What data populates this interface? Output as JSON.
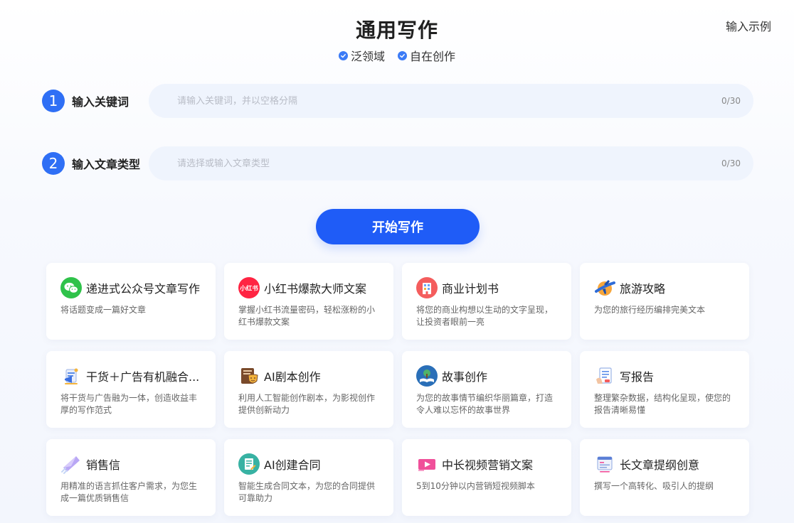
{
  "header": {
    "title": "通用写作",
    "tags": [
      "泛领域",
      "自在创作"
    ],
    "example_link": "输入示例"
  },
  "form": {
    "keyword": {
      "step": "1",
      "label": "输入关键词",
      "placeholder": "请输入关键词，并以空格分隔",
      "counter": "0/30"
    },
    "type": {
      "step": "2",
      "label": "输入文章类型",
      "placeholder": "请选择或输入文章类型",
      "counter": "0/30"
    }
  },
  "start_button": "开始写作",
  "cards": [
    {
      "title": "递进式公众号文章写作",
      "desc": "将话题变成一篇好文章",
      "icon": "wechat-icon"
    },
    {
      "title": "小红书爆款大师文案",
      "desc": "掌握小红书流量密码，轻松涨粉的小红书爆款文案",
      "icon": "xiaohongshu-icon",
      "icon_text": "小红书"
    },
    {
      "title": "商业计划书",
      "desc": "将您的商业构想以生动的文字呈现，让投资者眼前一亮",
      "icon": "building-icon"
    },
    {
      "title": "旅游攻略",
      "desc": "为您的旅行经历编排完美文本",
      "icon": "airplane-icon"
    },
    {
      "title": "干货＋广告有机融合...",
      "desc": "将干货与广告融为一体，创造收益丰厚的写作范式",
      "icon": "megaphone-icon"
    },
    {
      "title": "AI剧本创作",
      "desc": "利用人工智能创作剧本，为影视创作提供创新动力",
      "icon": "drama-mask-icon"
    },
    {
      "title": "故事创作",
      "desc": "为您的故事情节编织华丽篇章，打造令人难以忘怀的故事世界",
      "icon": "storybook-icon"
    },
    {
      "title": "写报告",
      "desc": "整理繁杂数据，结构化呈现，使您的报告清晰易懂",
      "icon": "report-icon"
    },
    {
      "title": "销售信",
      "desc": "用精准的语言抓住客户需求，为您生成一篇优质销售信",
      "icon": "letter-icon"
    },
    {
      "title": "AI创建合同",
      "desc": "智能生成合同文本，为您的合同提供可靠助力",
      "icon": "contract-icon"
    },
    {
      "title": "中长视频营销文案",
      "desc": "5到10分钟以内营销短视频脚本",
      "icon": "video-play-icon"
    },
    {
      "title": "长文章提纲创意",
      "desc": "撰写一个高转化、吸引人的提纲",
      "icon": "outline-icon"
    }
  ],
  "colors": {
    "primary": "#1f5cf7",
    "step": "#2f6ff5",
    "field_bg": "#eff4fd",
    "check": "#3b7bf6"
  }
}
